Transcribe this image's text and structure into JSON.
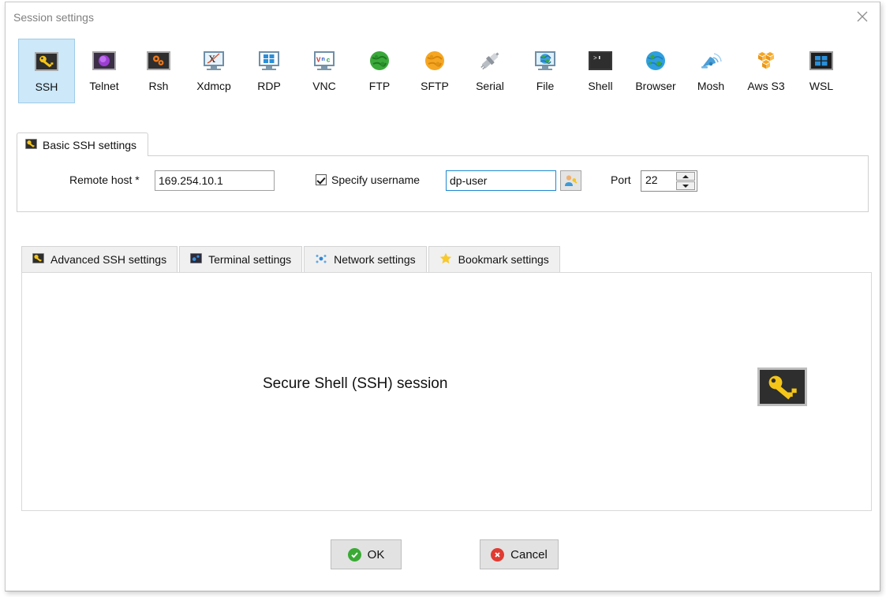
{
  "window": {
    "title": "Session settings",
    "close_icon": "close-icon"
  },
  "session_types": [
    {
      "label": "SSH",
      "icon": "ssh-key-icon",
      "selected": true
    },
    {
      "label": "Telnet",
      "icon": "telnet-icon",
      "selected": false
    },
    {
      "label": "Rsh",
      "icon": "rsh-gears-icon",
      "selected": false
    },
    {
      "label": "Xdmcp",
      "icon": "xdmcp-icon",
      "selected": false
    },
    {
      "label": "RDP",
      "icon": "rdp-windows-icon",
      "selected": false
    },
    {
      "label": "VNC",
      "icon": "vnc-icon",
      "selected": false
    },
    {
      "label": "FTP",
      "icon": "ftp-globe-icon",
      "selected": false
    },
    {
      "label": "SFTP",
      "icon": "sftp-globe-icon",
      "selected": false
    },
    {
      "label": "Serial",
      "icon": "serial-plug-icon",
      "selected": false
    },
    {
      "label": "File",
      "icon": "file-share-icon",
      "selected": false
    },
    {
      "label": "Shell",
      "icon": "shell-prompt-icon",
      "selected": false
    },
    {
      "label": "Browser",
      "icon": "browser-globe-icon",
      "selected": false
    },
    {
      "label": "Mosh",
      "icon": "mosh-dish-icon",
      "selected": false
    },
    {
      "label": "Aws S3",
      "icon": "aws-s3-icon",
      "selected": false
    },
    {
      "label": "WSL",
      "icon": "wsl-windows-icon",
      "selected": false
    }
  ],
  "basic_group": {
    "tab_label": "Basic SSH settings",
    "tab_icon": "ssh-key-icon",
    "remote_host_label": "Remote host *",
    "remote_host_value": "169.254.10.1",
    "specify_username_label": "Specify username",
    "specify_username_checked": true,
    "username_value": "dp-user",
    "username_placeholder": "",
    "user_browse_icon": "user-key-icon",
    "port_label": "Port",
    "port_value": "22",
    "spinner_up_icon": "chevron-up-icon",
    "spinner_down_icon": "chevron-down-icon"
  },
  "settings_tabs": [
    {
      "label": "Advanced SSH settings",
      "icon": "ssh-key-icon"
    },
    {
      "label": "Terminal settings",
      "icon": "terminal-icon"
    },
    {
      "label": "Network settings",
      "icon": "network-nodes-icon"
    },
    {
      "label": "Bookmark settings",
      "icon": "star-icon"
    }
  ],
  "panel": {
    "caption": "Secure Shell (SSH) session",
    "big_icon": "ssh-key-icon"
  },
  "buttons": {
    "ok_label": "OK",
    "ok_icon": "check-circle-icon",
    "cancel_label": "Cancel",
    "cancel_icon": "error-circle-icon"
  },
  "colors": {
    "selection_blue": "#cce8f9",
    "focus_blue": "#1e88d0",
    "key_yellow": "#f5c518",
    "ok_green": "#3aaa35",
    "cancel_red": "#e03b32",
    "star_yellow": "#f7c92b"
  }
}
